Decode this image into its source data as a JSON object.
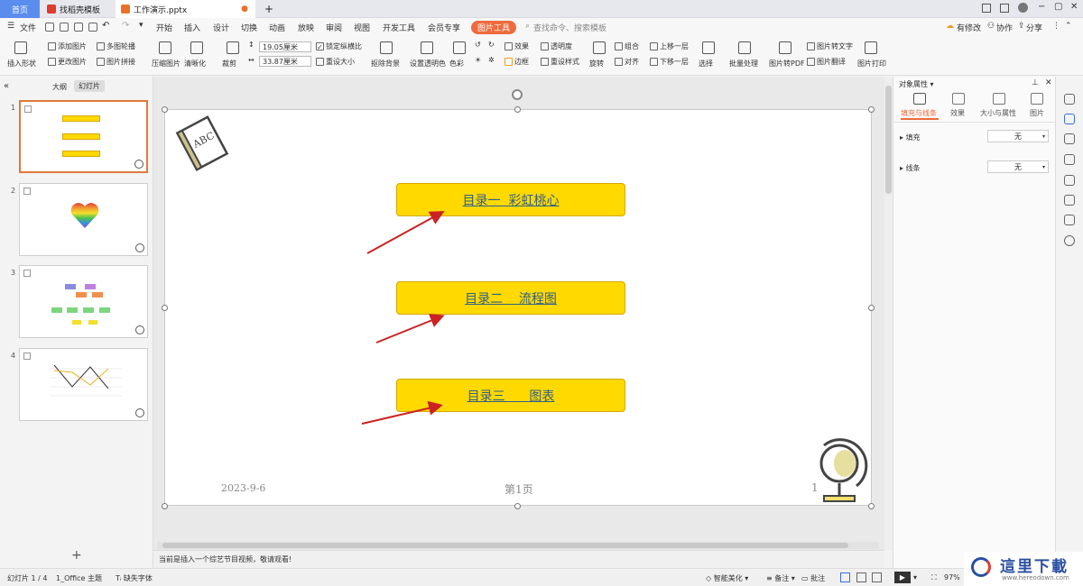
{
  "tabs": {
    "home": "首页",
    "template": "找稻壳模板",
    "file": "工作演示.pptx",
    "plus": "+"
  },
  "menu": {
    "file": "文件",
    "items": [
      "开始",
      "插入",
      "设计",
      "切换",
      "动画",
      "放映",
      "审阅",
      "视图",
      "开发工具",
      "会员专享"
    ],
    "active": "图片工具",
    "search_placeholder": "查找命令、搜索模板",
    "modify": "有修改",
    "collab": "协作",
    "share": "分享"
  },
  "ribbon": {
    "insert_shape": "插入形状",
    "add_image": "添加图片",
    "change_image": "更改图片",
    "multi_outline": "多图轮播",
    "image_stitch": "图片拼接",
    "compress": "压缩图片",
    "clarify": "清晰化",
    "crop": "裁剪",
    "height": "19.05厘米",
    "width": "33.87厘米",
    "lock_ratio": "锁定纵横比",
    "reset_size": "重设大小",
    "remove_bg": "抠除背景",
    "set_transparent": "设置透明色",
    "color": "色彩",
    "effect": "效果",
    "border": "边框",
    "transparency": "透明度",
    "reset_style": "重设样式",
    "rotate": "旋转",
    "group": "组合",
    "align": "对齐",
    "bring_forward": "上移一层",
    "send_backward": "下移一层",
    "select": "选择",
    "batch": "批量处理",
    "to_pdf": "图片转PDF",
    "to_text": "图片转文字",
    "translate": "图片翻译",
    "print": "图片打印"
  },
  "left": {
    "outline_tab": "大纲",
    "slides_tab": "幻灯片",
    "slide_numbers": [
      "1",
      "2",
      "3",
      "4"
    ],
    "add": "+"
  },
  "slide": {
    "toc": [
      "目录一  彩虹桃心",
      "目录二    流程图",
      "目录三      图表"
    ],
    "date": "2023-9-6",
    "page_label": "第1页",
    "page_num": "1",
    "book_text": "ABC"
  },
  "notes": {
    "text": "当前是插入一个综艺节目视频，敬请观看!"
  },
  "right": {
    "title": "对象属性",
    "tabs": [
      "填充与线条",
      "效果",
      "大小与属性",
      "图片"
    ],
    "fill_label": "填充",
    "fill_value": "无",
    "line_label": "线条",
    "line_value": "无"
  },
  "status": {
    "slide_info": "幻灯片 1 / 4",
    "theme": "1_Office 主题",
    "missing_font": "缺失字体",
    "smart": "智能美化",
    "notes": "备注",
    "comment": "批注",
    "zoom": "97%"
  },
  "watermark": {
    "text": "這里下載",
    "url": "www.hereodown.com"
  },
  "colors": {
    "accent": "#ef6a3d",
    "toc_fill": "#ffd900",
    "toc_text": "#2f5f8a",
    "arrow": "#cc2222",
    "selected_border": "#e07a3b"
  }
}
